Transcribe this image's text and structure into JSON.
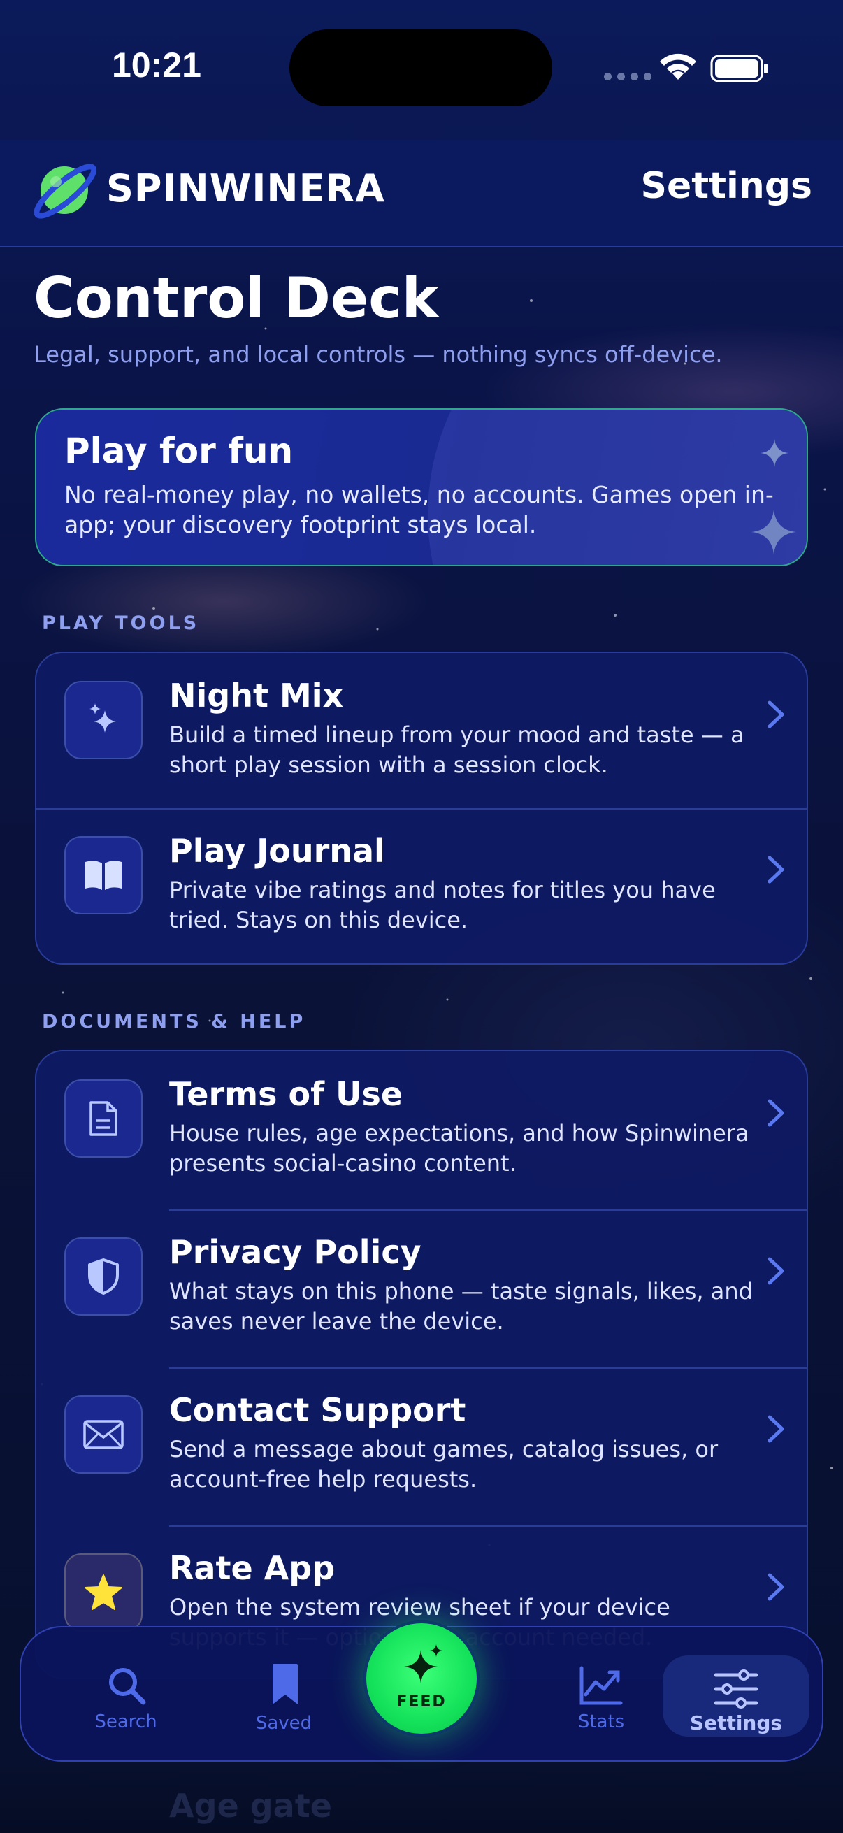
{
  "status_bar": {
    "time": "10:21"
  },
  "header": {
    "brand": "SPINWINERA",
    "settings_label": "Settings"
  },
  "page": {
    "title": "Control Deck",
    "subtitle": "Legal, support, and local controls — nothing syncs off-device."
  },
  "hero": {
    "title": "Play for fun",
    "text": "No real-money play, no wallets, no accounts. Games open in-app; your discovery footprint stays local."
  },
  "sections": {
    "play_tools": {
      "label": "PLAY TOOLS",
      "items": [
        {
          "icon": "sparkles-icon",
          "title": "Night Mix",
          "desc": "Build a timed lineup from your mood and taste — a short play session with a session clock."
        },
        {
          "icon": "book-icon",
          "title": "Play Journal",
          "desc": "Private vibe ratings and notes for titles you have tried. Stays on this device."
        }
      ]
    },
    "docs_help": {
      "label": "DOCUMENTS & HELP",
      "items": [
        {
          "icon": "document-icon",
          "title": "Terms of Use",
          "desc": "House rules, age expectations, and how Spinwinera presents social-casino content."
        },
        {
          "icon": "shield-icon",
          "title": "Privacy Policy",
          "desc": "What stays on this phone — taste signals, likes, and saves never leave the device."
        },
        {
          "icon": "envelope-icon",
          "title": "Contact Support",
          "desc": "Send a message about games, catalog issues, or account-free help requests."
        },
        {
          "icon": "star-icon",
          "title": "Rate App",
          "desc": "Open the system review sheet if your device supports it — optional, no account needed."
        }
      ]
    }
  },
  "peek": {
    "title": "Age gate"
  },
  "tab_bar": {
    "search": "Search",
    "saved": "Saved",
    "feed": "FEED",
    "stats": "Stats",
    "settings": "Settings",
    "active": "Settings"
  },
  "colors": {
    "background": "#0a1454",
    "accent_green": "#14e25a",
    "tab_blue": "#4f6ae8",
    "section_label": "#8f9ff0",
    "chevron": "#5a78f0"
  }
}
